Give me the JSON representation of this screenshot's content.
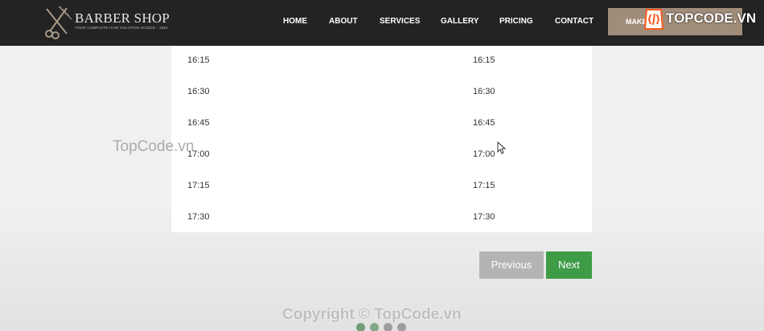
{
  "brand": {
    "name": "BARBER SHOP",
    "tagline": "YOUR COMPLETE HAIR SOLUTION SCINCE - 1952"
  },
  "nav": {
    "items": [
      "HOME",
      "ABOUT",
      "SERVICES",
      "GALLERY",
      "PRICING",
      "CONTACT"
    ],
    "appointment_label": "MAKE"
  },
  "time_slots": {
    "column_a": [
      "16:15",
      "16:30",
      "16:45",
      "17:00",
      "17:15",
      "17:30"
    ],
    "column_b": [
      "16:15",
      "16:30",
      "16:45",
      "17:00",
      "17:15",
      "17:30"
    ]
  },
  "pager": {
    "previous_label": "Previous",
    "next_label": "Next"
  },
  "watermark": {
    "badge": "TOPCODE.VN",
    "left": "TopCode.vn",
    "bottom": "Copyright © TopCode.vn"
  },
  "carousel": {
    "dot_count": 4,
    "active_index": 1
  },
  "colors": {
    "nav_bg": "#232323",
    "appointment_bg": "#a08c78",
    "next_bg": "#3e9c47",
    "previous_bg": "#b4b4b4",
    "dot_green": "#6f9e79",
    "dot_gray": "#9e9e9e"
  }
}
